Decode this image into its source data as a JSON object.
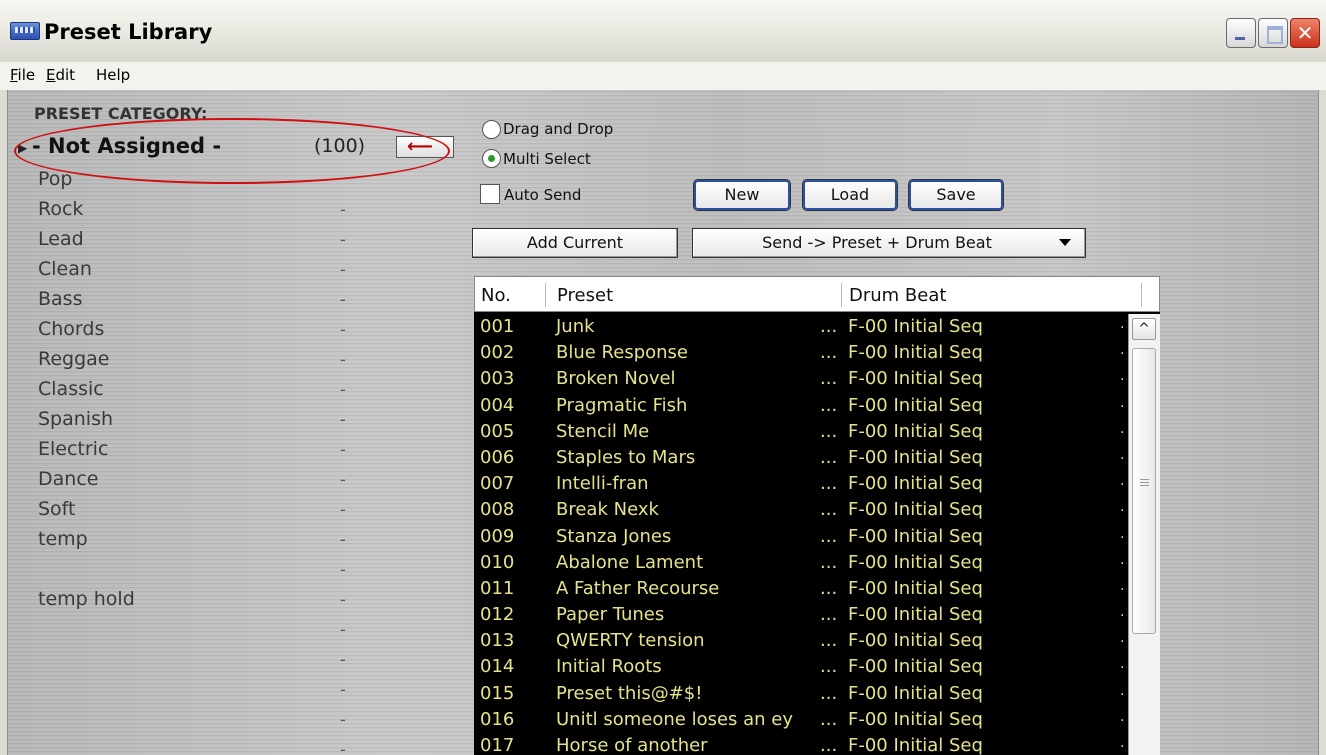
{
  "window": {
    "title": "Preset Library",
    "close_glyph": "✕"
  },
  "menu": [
    {
      "accel": "F",
      "rest": "ile"
    },
    {
      "accel": "E",
      "rest": "dit"
    },
    {
      "accel": "",
      "rest": "Help"
    }
  ],
  "category": {
    "header": "PRESET CATEGORY:",
    "selected": {
      "name": "- Not Assigned -",
      "count": "(100)",
      "arrow": "⟵"
    },
    "items": [
      {
        "label": "Pop",
        "dash": ""
      },
      {
        "label": "Rock",
        "dash": "-"
      },
      {
        "label": "Lead",
        "dash": "-"
      },
      {
        "label": "Clean",
        "dash": "-"
      },
      {
        "label": "Bass",
        "dash": "-"
      },
      {
        "label": "Chords",
        "dash": "-"
      },
      {
        "label": "Reggae",
        "dash": "-"
      },
      {
        "label": "Classic",
        "dash": "-"
      },
      {
        "label": "Spanish",
        "dash": "-"
      },
      {
        "label": "Electric",
        "dash": "-"
      },
      {
        "label": "Dance",
        "dash": "-"
      },
      {
        "label": "Soft",
        "dash": "-"
      },
      {
        "label": "temp",
        "dash": "-"
      },
      {
        "label": "",
        "dash": "-"
      },
      {
        "label": "temp hold",
        "dash": "-"
      },
      {
        "label": "",
        "dash": "-"
      },
      {
        "label": "",
        "dash": "-"
      },
      {
        "label": "",
        "dash": "-"
      },
      {
        "label": "",
        "dash": "-"
      },
      {
        "label": "",
        "dash": "-"
      }
    ]
  },
  "controls": {
    "drag_drop": "Drag and Drop",
    "multi_select": "Multi Select",
    "auto_send": "Auto Send",
    "new": "New",
    "load": "Load",
    "save": "Save",
    "add_current": "Add Current",
    "send_dropdown": "Send -> Preset + Drum Beat"
  },
  "table": {
    "columns": [
      "No.",
      "Preset",
      "Drum Beat"
    ],
    "dots": "...",
    "rows": [
      {
        "no": "001",
        "preset": "Junk",
        "drum": "F-00 Initial Seq"
      },
      {
        "no": "002",
        "preset": "Blue Response",
        "drum": "F-00 Initial Seq"
      },
      {
        "no": "003",
        "preset": "Broken Novel",
        "drum": "F-00 Initial Seq"
      },
      {
        "no": "004",
        "preset": "Pragmatic Fish",
        "drum": "F-00 Initial Seq"
      },
      {
        "no": "005",
        "preset": "Stencil Me",
        "drum": "F-00 Initial Seq"
      },
      {
        "no": "006",
        "preset": "Staples to Mars",
        "drum": "F-00 Initial Seq"
      },
      {
        "no": "007",
        "preset": "Intelli-fran",
        "drum": "F-00 Initial Seq"
      },
      {
        "no": "008",
        "preset": "Break Nexk",
        "drum": "F-00 Initial Seq"
      },
      {
        "no": "009",
        "preset": "Stanza Jones",
        "drum": "F-00 Initial Seq"
      },
      {
        "no": "010",
        "preset": "Abalone Lament",
        "drum": "F-00 Initial Seq"
      },
      {
        "no": "011",
        "preset": "A Father Recourse",
        "drum": "F-00 Initial Seq"
      },
      {
        "no": "012",
        "preset": "Paper Tunes",
        "drum": "F-00 Initial Seq"
      },
      {
        "no": "013",
        "preset": "QWERTY tension",
        "drum": "F-00 Initial Seq"
      },
      {
        "no": "014",
        "preset": "Initial Roots",
        "drum": "F-00 Initial Seq"
      },
      {
        "no": "015",
        "preset": "Preset this@#$!",
        "drum": "F-00 Initial Seq"
      },
      {
        "no": "016",
        "preset": "Unitl someone loses an ey",
        "drum": "F-00 Initial Seq"
      },
      {
        "no": "017",
        "preset": "Horse of another",
        "drum": "F-00 Initial Seq"
      }
    ]
  },
  "scrollbar": {
    "up_glyph": "^"
  }
}
